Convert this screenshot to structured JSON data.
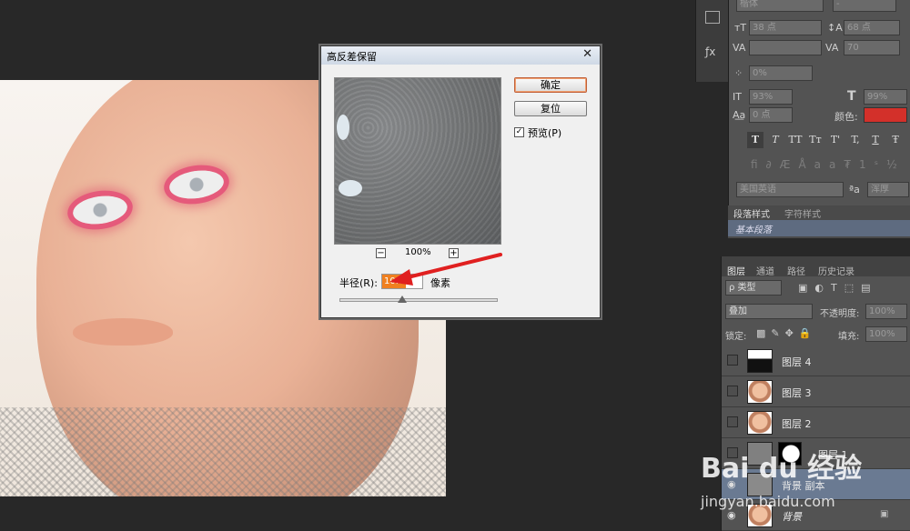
{
  "dialog": {
    "title": "高反差保留",
    "ok_label": "确定",
    "reset_label": "复位",
    "preview_label": "预览(P)",
    "preview_checked": "✓",
    "zoom": "100%",
    "zoom_out": "−",
    "zoom_in": "+",
    "radius_label": "半径(R):",
    "radius_value": "10.0",
    "radius_unit": "像素",
    "close": "✕"
  },
  "character_panel": {
    "font_family": "楷体",
    "font_style": "-",
    "font_size": "38 点",
    "leading": "68 点",
    "tracking": "70",
    "kerning": "",
    "baseline_scale": "0%",
    "vertical_scale": "93%",
    "horizontal_scale": "99%",
    "baseline_shift": "0 点",
    "color_label": "颜色:",
    "color_value": "#d3302a",
    "language": "美国英语",
    "aa_label": "ªa",
    "antialias": "浑厚",
    "type_buttons": [
      "T",
      "T",
      "TT",
      "Tт",
      "T'",
      "T,",
      "T",
      "Ŧ"
    ]
  },
  "paragraph_panel": {
    "tabs": [
      "段落样式",
      "字符样式"
    ],
    "item": "基本段落"
  },
  "layers_panel": {
    "tabs": [
      "图层",
      "通道",
      "路径",
      "历史记录"
    ],
    "filter_kind": "ρ 类型",
    "blend_mode": "叠加",
    "opacity_label": "不透明度:",
    "opacity_value": "100%",
    "lock_label": "锁定:",
    "fill_label": "填充:",
    "fill_value": "100%",
    "layers": [
      {
        "name": "图层 4"
      },
      {
        "name": "图层 3"
      },
      {
        "name": "图层 2"
      },
      {
        "name": "图层 1"
      },
      {
        "name": "背景 副本"
      },
      {
        "name": "背景"
      }
    ]
  },
  "watermark": {
    "brand": "Bai du 经验",
    "url": "jingyan.baidu.com"
  },
  "colors": {
    "accent_orange": "#f08020",
    "swatch_red": "#d3302a",
    "arrow_red": "#e02020"
  }
}
